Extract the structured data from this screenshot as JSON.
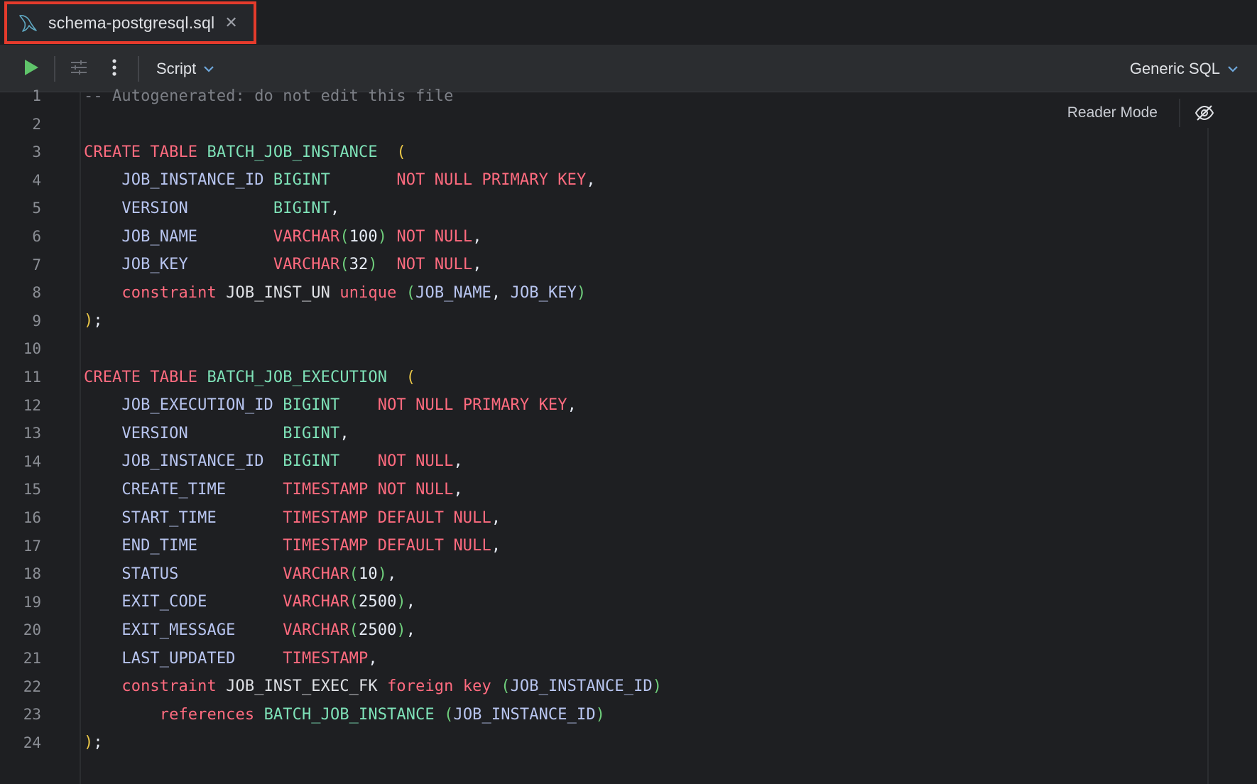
{
  "tab": {
    "filename": "schema-postgresql.sql",
    "close_glyph": "✕",
    "file_icon": "mysql-dolphin-icon"
  },
  "toolbar": {
    "run_icon": "play-icon",
    "settings_icon": "sliders-icon",
    "more_icon": "more-vertical-icon",
    "script_label": "Script",
    "dialect_label": "Generic SQL"
  },
  "editor": {
    "reader_mode_label": "Reader Mode",
    "reader_toggle_icon": "eye-off-icon",
    "line_numbers": [
      "1",
      "2",
      "3",
      "4",
      "5",
      "6",
      "7",
      "8",
      "9",
      "10",
      "11",
      "12",
      "13",
      "14",
      "15",
      "16",
      "17",
      "18",
      "19",
      "20",
      "21",
      "22",
      "23",
      "24"
    ],
    "lines": [
      [
        [
          "cm",
          "-- Autogenerated: do not edit this file"
        ]
      ],
      [],
      [
        [
          "kw",
          "CREATE TABLE "
        ],
        [
          "tb",
          "BATCH_JOB_INSTANCE"
        ],
        [
          "id",
          "  "
        ],
        [
          "pn",
          "("
        ]
      ],
      [
        [
          "id",
          "    JOB_INSTANCE_ID "
        ],
        [
          "tb",
          "BIGINT"
        ],
        [
          "id",
          "       "
        ],
        [
          "kw",
          "NOT NULL PRIMARY KEY"
        ],
        [
          "pt",
          ","
        ]
      ],
      [
        [
          "id",
          "    VERSION         "
        ],
        [
          "tb",
          "BIGINT"
        ],
        [
          "pt",
          ","
        ]
      ],
      [
        [
          "id",
          "    JOB_NAME        "
        ],
        [
          "kw",
          "VARCHAR"
        ],
        [
          "ap",
          "("
        ],
        [
          "nu",
          "100"
        ],
        [
          "ap",
          ")"
        ],
        [
          "id",
          " "
        ],
        [
          "kw",
          "NOT NULL"
        ],
        [
          "pt",
          ","
        ]
      ],
      [
        [
          "id",
          "    JOB_KEY         "
        ],
        [
          "kw",
          "VARCHAR"
        ],
        [
          "ap",
          "("
        ],
        [
          "nu",
          "32"
        ],
        [
          "ap",
          ")"
        ],
        [
          "id",
          "  "
        ],
        [
          "kw",
          "NOT NULL"
        ],
        [
          "pt",
          ","
        ]
      ],
      [
        [
          "id",
          "    "
        ],
        [
          "kw",
          "constraint "
        ],
        [
          "cn",
          "JOB_INST_UN "
        ],
        [
          "kw",
          "unique "
        ],
        [
          "ap",
          "("
        ],
        [
          "id",
          "JOB_NAME"
        ],
        [
          "pt",
          ", "
        ],
        [
          "id",
          "JOB_KEY"
        ],
        [
          "ap",
          ")"
        ]
      ],
      [
        [
          "pn",
          ")"
        ],
        [
          "pt",
          ";"
        ]
      ],
      [],
      [
        [
          "kw",
          "CREATE TABLE "
        ],
        [
          "tb",
          "BATCH_JOB_EXECUTION"
        ],
        [
          "id",
          "  "
        ],
        [
          "pn",
          "("
        ]
      ],
      [
        [
          "id",
          "    JOB_EXECUTION_ID "
        ],
        [
          "tb",
          "BIGINT"
        ],
        [
          "id",
          "    "
        ],
        [
          "kw",
          "NOT NULL PRIMARY KEY"
        ],
        [
          "pt",
          ","
        ]
      ],
      [
        [
          "id",
          "    VERSION          "
        ],
        [
          "tb",
          "BIGINT"
        ],
        [
          "pt",
          ","
        ]
      ],
      [
        [
          "id",
          "    JOB_INSTANCE_ID  "
        ],
        [
          "tb",
          "BIGINT"
        ],
        [
          "id",
          "    "
        ],
        [
          "kw",
          "NOT NULL"
        ],
        [
          "pt",
          ","
        ]
      ],
      [
        [
          "id",
          "    CREATE_TIME      "
        ],
        [
          "kw",
          "TIMESTAMP NOT NULL"
        ],
        [
          "pt",
          ","
        ]
      ],
      [
        [
          "id",
          "    START_TIME       "
        ],
        [
          "kw",
          "TIMESTAMP DEFAULT NULL"
        ],
        [
          "pt",
          ","
        ]
      ],
      [
        [
          "id",
          "    END_TIME         "
        ],
        [
          "kw",
          "TIMESTAMP DEFAULT NULL"
        ],
        [
          "pt",
          ","
        ]
      ],
      [
        [
          "id",
          "    STATUS           "
        ],
        [
          "kw",
          "VARCHAR"
        ],
        [
          "ap",
          "("
        ],
        [
          "nu",
          "10"
        ],
        [
          "ap",
          ")"
        ],
        [
          "pt",
          ","
        ]
      ],
      [
        [
          "id",
          "    EXIT_CODE        "
        ],
        [
          "kw",
          "VARCHAR"
        ],
        [
          "ap",
          "("
        ],
        [
          "nu",
          "2500"
        ],
        [
          "ap",
          ")"
        ],
        [
          "pt",
          ","
        ]
      ],
      [
        [
          "id",
          "    EXIT_MESSAGE     "
        ],
        [
          "kw",
          "VARCHAR"
        ],
        [
          "ap",
          "("
        ],
        [
          "nu",
          "2500"
        ],
        [
          "ap",
          ")"
        ],
        [
          "pt",
          ","
        ]
      ],
      [
        [
          "id",
          "    LAST_UPDATED     "
        ],
        [
          "kw",
          "TIMESTAMP"
        ],
        [
          "pt",
          ","
        ]
      ],
      [
        [
          "id",
          "    "
        ],
        [
          "kw",
          "constraint "
        ],
        [
          "cn",
          "JOB_INST_EXEC_FK "
        ],
        [
          "kw",
          "foreign key "
        ],
        [
          "ap",
          "("
        ],
        [
          "id",
          "JOB_INSTANCE_ID"
        ],
        [
          "ap",
          ")"
        ]
      ],
      [
        [
          "id",
          "        "
        ],
        [
          "kw",
          "references "
        ],
        [
          "tb",
          "BATCH_JOB_INSTANCE "
        ],
        [
          "ap",
          "("
        ],
        [
          "id",
          "JOB_INSTANCE_ID"
        ],
        [
          "ap",
          ")"
        ]
      ],
      [
        [
          "pn",
          ")"
        ],
        [
          "pt",
          ";"
        ]
      ]
    ]
  }
}
